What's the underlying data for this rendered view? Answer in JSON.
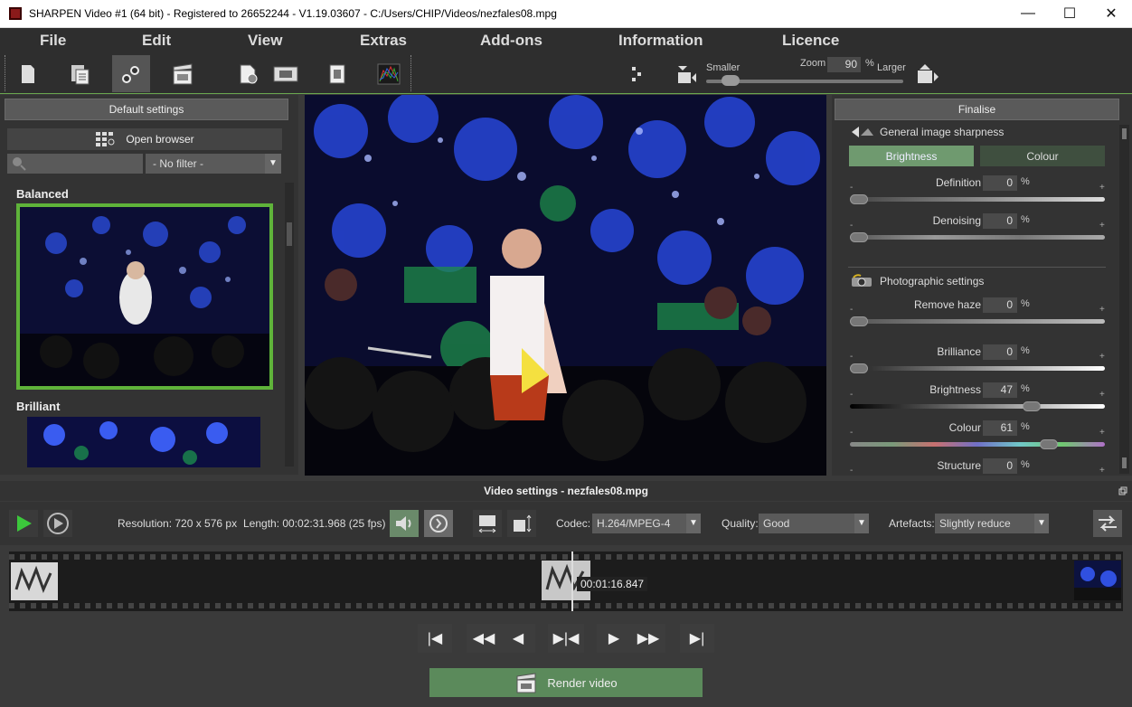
{
  "window": {
    "title": "SHARPEN Video #1 (64 bit) - Registered to 26652244 - V1.19.03607 - C:/Users/CHIP/Videos/nezfales08.mpg"
  },
  "menu": [
    "File",
    "Edit",
    "View",
    "Extras",
    "Add-ons",
    "Information",
    "Licence"
  ],
  "zoom": {
    "label": "Zoom",
    "value": "90",
    "unit": "%",
    "smaller": "Smaller",
    "larger": "Larger"
  },
  "left_panel": {
    "default_settings": "Default settings",
    "open_browser": "Open browser",
    "filter": "- No filter -",
    "presets": [
      "Balanced",
      "Brilliant"
    ]
  },
  "right_panel": {
    "finalise": "Finalise",
    "general_title": "General image sharpness",
    "tab_brightness": "Brightness",
    "tab_colour": "Colour",
    "definition": {
      "label": "Definition",
      "value": "0"
    },
    "denoising": {
      "label": "Denoising",
      "value": "0"
    },
    "photo_title": "Photographic settings",
    "remove_haze": {
      "label": "Remove haze",
      "value": "0"
    },
    "brilliance": {
      "label": "Brilliance",
      "value": "0"
    },
    "brightness": {
      "label": "Brightness",
      "value": "47"
    },
    "colour": {
      "label": "Colour",
      "value": "61"
    },
    "structure": {
      "label": "Structure",
      "value": "0"
    },
    "pct": "%",
    "minus": "-",
    "plus": "+"
  },
  "video_settings": {
    "title": "Video settings - nezfales08.mpg",
    "resolution": "Resolution: 720 x 576 px",
    "length": "Length: 00:02:31.968 (25 fps)",
    "codec_label": "Codec:",
    "codec_value": "H.264/MPEG-4",
    "quality_label": "Quality:",
    "quality_value": "Good",
    "artefacts_label": "Artefacts:",
    "artefacts_value": "Slightly reduce"
  },
  "timeline": {
    "current_time": "00:01:16.847"
  },
  "render": {
    "label": "Render video"
  },
  "colors": {
    "accent_green": "#6aa84f",
    "panel_bg": "#333333",
    "render_bg": "#5b8a5b"
  }
}
